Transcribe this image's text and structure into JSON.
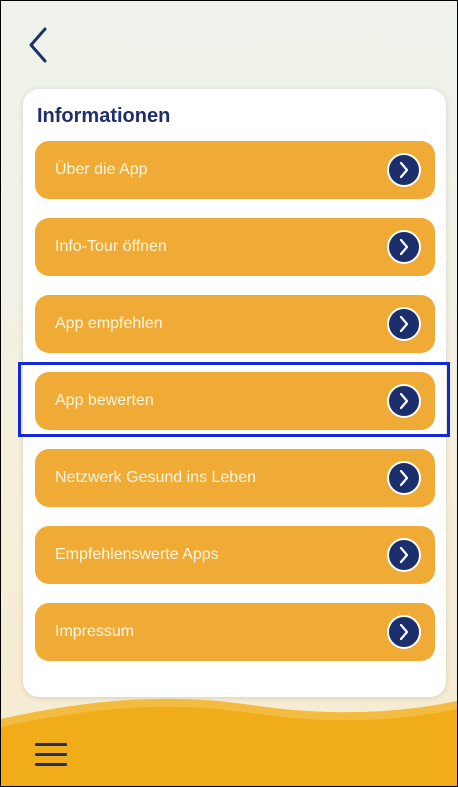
{
  "header": {
    "back_icon": "chevron-left-icon"
  },
  "section": {
    "title": "Informationen"
  },
  "menu": {
    "items": [
      {
        "label": "Über die App"
      },
      {
        "label": "Info-Tour öffnen"
      },
      {
        "label": "App empfehlen"
      },
      {
        "label": "App bewerten"
      },
      {
        "label": "Netzwerk Gesund ins Leben"
      },
      {
        "label": "Empfehlenswerte Apps"
      },
      {
        "label": "Impressum"
      }
    ],
    "item_icon": "chevron-right-circle-icon"
  },
  "footer": {
    "menu_icon": "hamburger-menu-icon"
  },
  "colors": {
    "accent": "#efab35",
    "primary": "#1f2f6b",
    "highlight": "#1328d6"
  }
}
